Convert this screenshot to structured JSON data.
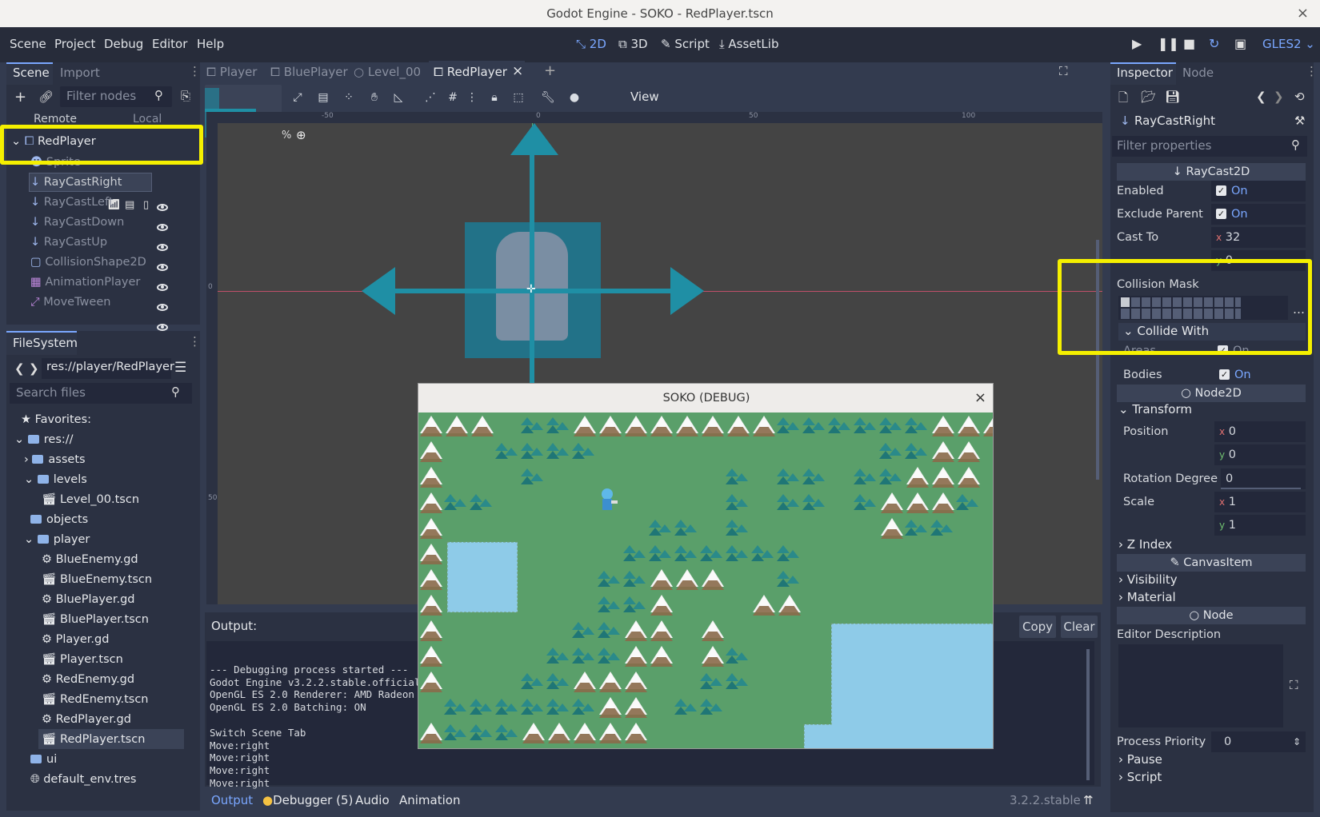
{
  "window": {
    "title": "Godot Engine - SOKO - RedPlayer.tscn",
    "close": "×"
  },
  "menu": {
    "items": [
      "Scene",
      "Project",
      "Debug",
      "Editor",
      "Help"
    ]
  },
  "workspaces": {
    "b2d": "2D",
    "b3d": "3D",
    "script": "Script",
    "assetlib": "AssetLib"
  },
  "renderer": "GLES2",
  "scene_panel": {
    "tab_scene": "Scene",
    "tab_import": "Import",
    "filter_placeholder": "Filter nodes",
    "remote": "Remote",
    "local": "Local",
    "nodes": [
      {
        "name": "RedPlayer"
      },
      {
        "name": "Sprite"
      },
      {
        "name": "RayCastRight"
      },
      {
        "name": "RayCastLeft"
      },
      {
        "name": "RayCastDown"
      },
      {
        "name": "RayCastUp"
      },
      {
        "name": "CollisionShape2D"
      },
      {
        "name": "AnimationPlayer"
      },
      {
        "name": "MoveTween"
      }
    ]
  },
  "filesystem": {
    "title": "FileSystem",
    "path": "res://player/RedPlayer",
    "search_placeholder": "Search files",
    "items": [
      "Favorites:",
      "res://",
      "assets",
      "levels",
      "Level_00.tscn",
      "objects",
      "player",
      "BlueEnemy.gd",
      "BlueEnemy.tscn",
      "BluePlayer.gd",
      "BluePlayer.tscn",
      "Player.gd",
      "Player.tscn",
      "RedEnemy.gd",
      "RedEnemy.tscn",
      "RedPlayer.gd",
      "RedPlayer.tscn",
      "ui",
      "default_env.tres"
    ]
  },
  "scene_tabs": [
    "Player",
    "BluePlayer",
    "Level_00",
    "RedPlayer"
  ],
  "viewport": {
    "view_menu": "View",
    "ruler_top": [
      "-50",
      "0",
      "50",
      "100"
    ],
    "ruler_left": [
      "0",
      "50"
    ],
    "zoom_tail": "%"
  },
  "output": {
    "label": "Output:",
    "copy": "Copy",
    "clear": "Clear",
    "lines": [
      "--- Debugging process started ---",
      "Godot Engine v3.2.2.stable.official",
      "OpenGL ES 2.0 Renderer: AMD Radeon",
      "OpenGL ES 2.0 Batching: ON",
      "",
      "Switch Scene Tab",
      "Move:right",
      "Move:right",
      "Move:right",
      "Move:right"
    ],
    "tabs": {
      "output": "Output",
      "debugger": "Debugger (5)",
      "audio": "Audio",
      "animation": "Animation"
    },
    "version": "3.2.2.stable"
  },
  "debug_window": {
    "title": "SOKO (DEBUG)",
    "close": "×"
  },
  "inspector": {
    "tab_inspector": "Inspector",
    "tab_node": "Node",
    "object": "RayCastRight",
    "filter_placeholder": "Filter properties",
    "sec_raycast": "RayCast2D",
    "enabled_label": "Enabled",
    "enabled_val": "On",
    "exclude_label": "Exclude Parent",
    "exclude_val": "On",
    "castto_label": "Cast To",
    "castto_x": "32",
    "castto_y": "0",
    "mask_label": "Collision Mask",
    "collide_with": "Collide With",
    "areas_label": "Areas",
    "areas_val": "On",
    "bodies_label": "Bodies",
    "bodies_val": "On",
    "sec_node2d": "Node2D",
    "transform": "Transform",
    "position_label": "Position",
    "pos_x": "0",
    "pos_y": "0",
    "rotation_label": "Rotation Degree",
    "rotation_val": "0",
    "scale_label": "Scale",
    "scale_x": "1",
    "scale_y": "1",
    "zindex": "Z Index",
    "sec_canvas": "CanvasItem",
    "visibility": "Visibility",
    "material": "Material",
    "sec_node": "Node",
    "editor_desc": "Editor Description",
    "priority_label": "Process Priority",
    "priority_val": "0",
    "pause": "Pause",
    "script": "Script",
    "axis_x": "x",
    "axis_y": "y"
  },
  "colors": {
    "accent": "#7aa7ff",
    "highlight": "#f5f000",
    "grass": "#5a9f6a",
    "water": "#8ecbe8"
  }
}
